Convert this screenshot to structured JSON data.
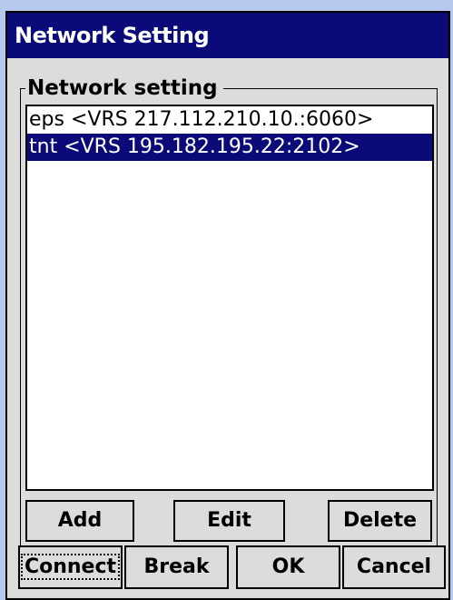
{
  "window": {
    "title": "Network Setting"
  },
  "group": {
    "label": "Network setting"
  },
  "list": {
    "items": [
      {
        "text": "eps <VRS  217.112.210.10.:6060>",
        "selected": false
      },
      {
        "text": "tnt <VRS  195.182.195.22:2102>",
        "selected": true
      }
    ]
  },
  "buttons": {
    "add": "Add",
    "edit": "Edit",
    "delete": "Delete",
    "connect": "Connect",
    "break": "Break",
    "ok": "OK",
    "cancel": "Cancel"
  },
  "colors": {
    "title_bg": "#0a0a78",
    "selection_bg": "#0a0a78",
    "window_bg": "#dcdcdc",
    "desktop_bg": "#b7c8ee"
  }
}
